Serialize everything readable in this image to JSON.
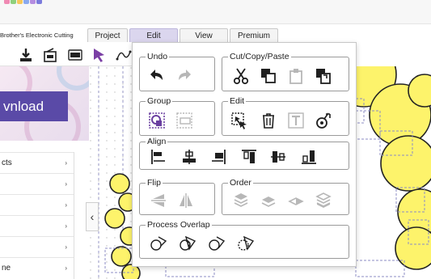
{
  "app": {
    "title": "Brother's Electronic Cutting"
  },
  "tabs": [
    {
      "label": "Project"
    },
    {
      "label": "Edit"
    },
    {
      "label": "View"
    },
    {
      "label": "Premium"
    }
  ],
  "toolbar": {
    "icons": [
      "download-icon",
      "import-icon",
      "svg-icon",
      "select-arrow-icon",
      "node-edit-icon"
    ],
    "svg_badge": "SVG"
  },
  "banner": {
    "download_label": "vnload"
  },
  "sidebar": {
    "items": [
      {
        "label": "cts"
      },
      {
        "label": ""
      },
      {
        "label": ""
      },
      {
        "label": ""
      },
      {
        "label": ""
      },
      {
        "label": "ne"
      }
    ],
    "chevron": "›"
  },
  "collapse": {
    "glyph": "‹"
  },
  "edit_menu": {
    "undo": {
      "title": "Undo",
      "icons": [
        "undo-icon",
        "redo-icon"
      ]
    },
    "cut_copy_paste": {
      "title": "Cut/Copy/Paste",
      "icons": [
        "cut-icon",
        "copy-icon",
        "paste-icon",
        "paste-in-place-icon"
      ]
    },
    "group": {
      "title": "Group",
      "icons": [
        "group-icon",
        "ungroup-icon"
      ]
    },
    "edit": {
      "title": "Edit",
      "icons": [
        "select-all-icon",
        "delete-icon",
        "text-icon",
        "weld-icon"
      ]
    },
    "align": {
      "title": "Align",
      "icons": [
        "align-left-icon",
        "align-center-icon",
        "align-right-icon",
        "align-top-icon",
        "align-middle-icon",
        "align-bottom-icon"
      ]
    },
    "flip": {
      "title": "Flip",
      "icons": [
        "flip-vertical-icon",
        "flip-horizontal-icon"
      ]
    },
    "order": {
      "title": "Order",
      "icons": [
        "bring-to-front-icon",
        "send-backward-icon",
        "bring-forward-icon",
        "send-to-back-icon"
      ]
    },
    "process_overlap": {
      "title": "Process Overlap",
      "icons": [
        "weld-overlap-icon",
        "intersect-overlap-icon",
        "exclude-overlap-icon",
        "trim-overlap-icon"
      ]
    }
  },
  "colors": {
    "accent_purple": "#5a4aa7",
    "icon_purple": "#6a3fa0",
    "tab_active": "#dbd6ee",
    "shape_yellow": "#fdf36b",
    "disabled_grey": "#b7b7b7",
    "icon_dark": "#1f1f1f"
  }
}
